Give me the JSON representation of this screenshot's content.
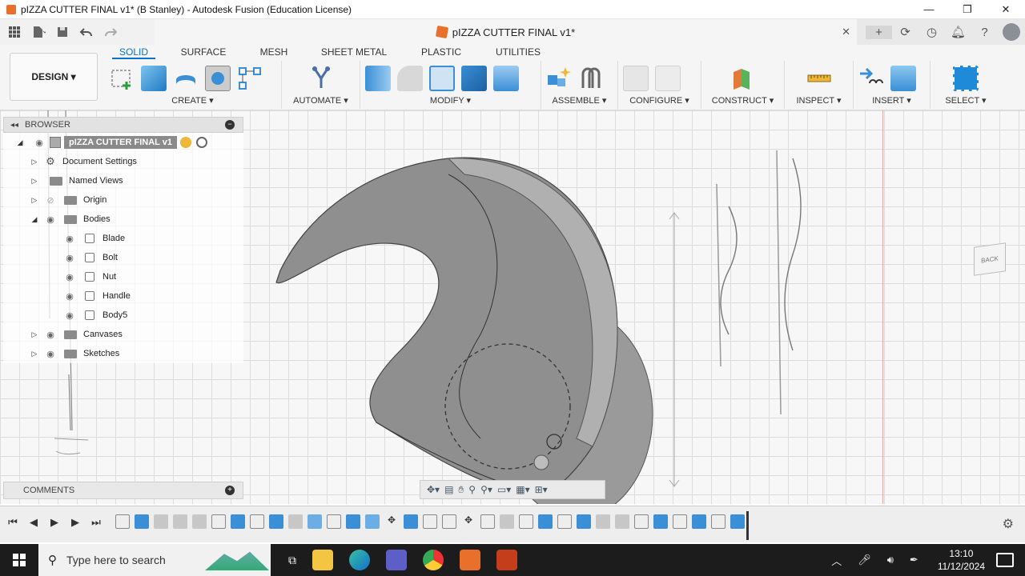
{
  "window": {
    "title": "pIZZA CUTTER FINAL v1* (B Stanley) - Autodesk Fusion (Education License)",
    "controls": [
      "—",
      "❐",
      "✕"
    ]
  },
  "document_tab": {
    "title": "pIZZA CUTTER FINAL v1*"
  },
  "toolbar": {
    "workspace": "DESIGN ▾",
    "tabs": [
      "SOLID",
      "SURFACE",
      "MESH",
      "SHEET METAL",
      "PLASTIC",
      "UTILITIES"
    ],
    "active_tab": "SOLID",
    "groups": {
      "create": "CREATE ▾",
      "automate": "AUTOMATE ▾",
      "modify": "MODIFY ▾",
      "assemble": "ASSEMBLE ▾",
      "configure": "CONFIGURE ▾",
      "construct": "CONSTRUCT ▾",
      "inspect": "INSPECT ▾",
      "insert": "INSERT ▾",
      "select": "SELECT ▾"
    }
  },
  "browser": {
    "header": "BROWSER",
    "root": "pIZZA CUTTER FINAL v1",
    "items": {
      "doc_settings": "Document Settings",
      "named_views": "Named Views",
      "origin": "Origin",
      "bodies": "Bodies",
      "canvases": "Canvases",
      "sketches": "Sketches"
    },
    "bodies": [
      "Blade",
      "Bolt",
      "Nut",
      "Handle",
      "Body5"
    ]
  },
  "comments": {
    "label": "COMMENTS"
  },
  "viewcube": {
    "face_label": "BACK"
  },
  "taskbar": {
    "search_placeholder": "Type here to search",
    "time": "13:10",
    "date": "11/12/2024"
  },
  "colors": {
    "accent": "#0a72c6",
    "fusion_orange": "#e8702a",
    "model_gray": "#8f8f8f"
  }
}
